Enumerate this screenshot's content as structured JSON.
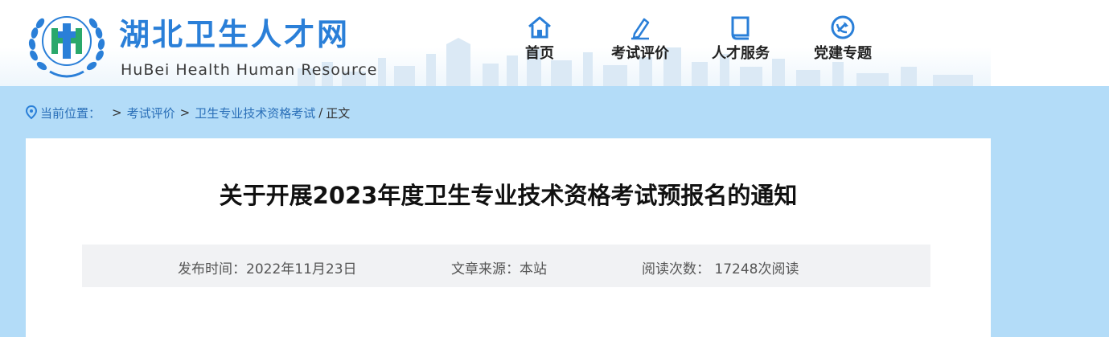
{
  "site": {
    "name_cn": "湖北卫生人才网",
    "name_en": "HuBei  Health Human Resource"
  },
  "nav": [
    {
      "label": "首页",
      "icon": "home-icon"
    },
    {
      "label": "考试评价",
      "icon": "edit-pencil-icon"
    },
    {
      "label": "人才服务",
      "icon": "book-icon"
    },
    {
      "label": "党建专题",
      "icon": "party-emblem-icon"
    }
  ],
  "breadcrumb": {
    "location_label": "当前位置：",
    "sep1": ">",
    "item1": "考试评价",
    "sep2": ">",
    "item2": "卫生专业技术资格考试",
    "sep3": "/",
    "current": "正文"
  },
  "article": {
    "title": "关于开展2023年度卫生专业技术资格考试预报名的通知",
    "publish_time": "发布时间：2022年11月23日",
    "source": "文章来源：本站",
    "read_count": "阅读次数： 17248次阅读"
  },
  "colors": {
    "brand_blue": "#2a7fd8",
    "page_bg": "#b3dcf8",
    "meta_bg": "#f1f2f4"
  }
}
